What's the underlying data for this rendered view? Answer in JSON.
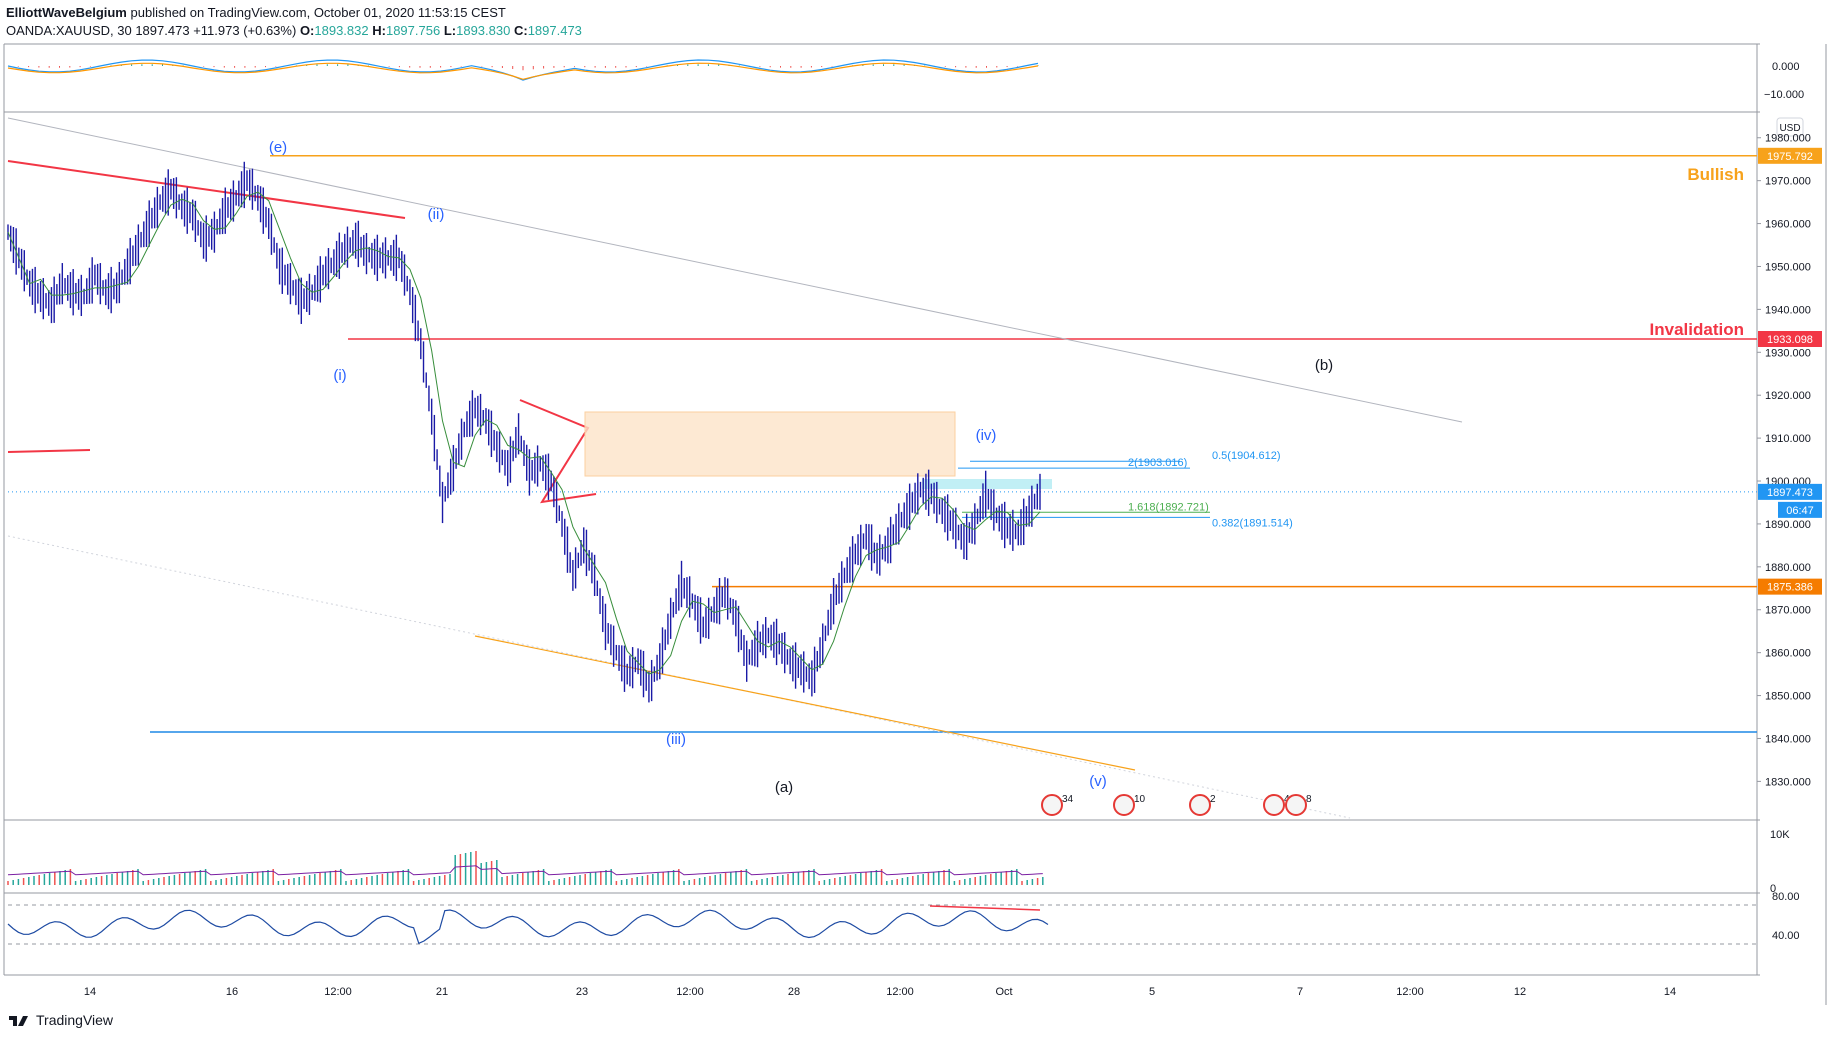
{
  "header": {
    "publisher": "ElliottWaveBelgium",
    "published_text": "published on TradingView.com, October 01, 2020 11:53:15 CEST",
    "symbol": "OANDA:XAUUSD, 30",
    "last": "1897.473",
    "change": "+11.973 (+0.63%)",
    "o_label": "O:",
    "o_value": "1893.832",
    "h_label": "H:",
    "h_value": "1897.756",
    "l_label": "L:",
    "l_value": "1893.830",
    "c_label": "C:",
    "c_value": "1897.473"
  },
  "footer": {
    "brand": "TradingView"
  },
  "chart_data": {
    "type": "line",
    "main_pane": {
      "currency_badge": "USD",
      "y_ticks": [
        1980,
        1970,
        1960,
        1950,
        1940,
        1930,
        1920,
        1910,
        1900,
        1890,
        1880,
        1870,
        1860,
        1850,
        1840,
        1830
      ],
      "y_tick_labels": [
        "1980.000",
        "1970.000",
        "1960.000",
        "1950.000",
        "1940.000",
        "1930.000",
        "1920.000",
        "1910.000",
        "1900.000",
        "1890.000",
        "1880.000",
        "1870.000",
        "1860.000",
        "1850.000",
        "1840.000",
        "1830.000"
      ],
      "ylim": [
        1821,
        1986
      ],
      "price_labels": [
        {
          "value": 1975.792,
          "text": "1975.792",
          "color": "#f7a21b"
        },
        {
          "value": 1933.098,
          "text": "1933.098",
          "color": "#f23645"
        },
        {
          "value": 1897.473,
          "text": "1897.473",
          "color": "#2196f3"
        },
        {
          "value": 1875.386,
          "text": "1875.386",
          "color": "#f57c00"
        }
      ],
      "countdown": "06:47",
      "price_series": [
        [
          0,
          1958
        ],
        [
          2,
          1952
        ],
        [
          4,
          1946
        ],
        [
          6,
          1943
        ],
        [
          8,
          1941
        ],
        [
          10,
          1946
        ],
        [
          12,
          1944
        ],
        [
          14,
          1943
        ],
        [
          16,
          1948
        ],
        [
          18,
          1944
        ],
        [
          20,
          1945
        ],
        [
          22,
          1950
        ],
        [
          24,
          1955
        ],
        [
          26,
          1960
        ],
        [
          28,
          1965
        ],
        [
          30,
          1968
        ],
        [
          32,
          1964
        ],
        [
          34,
          1962
        ],
        [
          36,
          1956
        ],
        [
          38,
          1958
        ],
        [
          40,
          1963
        ],
        [
          42,
          1966
        ],
        [
          44,
          1970
        ],
        [
          46,
          1966
        ],
        [
          48,
          1960
        ],
        [
          50,
          1950
        ],
        [
          52,
          1946
        ],
        [
          54,
          1942
        ],
        [
          56,
          1944
        ],
        [
          58,
          1948
        ],
        [
          60,
          1951
        ],
        [
          62,
          1954
        ],
        [
          64,
          1956
        ],
        [
          66,
          1953
        ],
        [
          68,
          1952
        ],
        [
          70,
          1952
        ],
        [
          72,
          1952
        ],
        [
          74,
          1944
        ],
        [
          76,
          1932
        ],
        [
          78,
          1915
        ],
        [
          80,
          1895
        ],
        [
          82,
          1903
        ],
        [
          84,
          1912
        ],
        [
          86,
          1917
        ],
        [
          88,
          1914
        ],
        [
          90,
          1908
        ],
        [
          92,
          1903
        ],
        [
          94,
          1911
        ],
        [
          96,
          1902
        ],
        [
          98,
          1904
        ],
        [
          100,
          1900
        ],
        [
          102,
          1890
        ],
        [
          104,
          1878
        ],
        [
          106,
          1885
        ],
        [
          108,
          1878
        ],
        [
          110,
          1866
        ],
        [
          112,
          1860
        ],
        [
          114,
          1855
        ],
        [
          116,
          1858
        ],
        [
          118,
          1852
        ],
        [
          120,
          1858
        ],
        [
          122,
          1868
        ],
        [
          124,
          1876
        ],
        [
          126,
          1872
        ],
        [
          128,
          1866
        ],
        [
          130,
          1870
        ],
        [
          132,
          1874
        ],
        [
          134,
          1868
        ],
        [
          136,
          1858
        ],
        [
          138,
          1862
        ],
        [
          140,
          1864
        ],
        [
          142,
          1862
        ],
        [
          144,
          1858
        ],
        [
          146,
          1856
        ],
        [
          148,
          1854
        ],
        [
          150,
          1862
        ],
        [
          152,
          1872
        ],
        [
          154,
          1878
        ],
        [
          156,
          1883
        ],
        [
          158,
          1887
        ],
        [
          160,
          1882
        ],
        [
          162,
          1885
        ],
        [
          164,
          1890
        ],
        [
          166,
          1894
        ],
        [
          168,
          1898
        ],
        [
          170,
          1897
        ],
        [
          172,
          1893
        ],
        [
          174,
          1890
        ],
        [
          176,
          1886
        ],
        [
          178,
          1890
        ],
        [
          180,
          1897
        ],
        [
          182,
          1892
        ],
        [
          184,
          1889
        ],
        [
          186,
          1888
        ],
        [
          188,
          1893
        ],
        [
          190,
          1897.473
        ]
      ],
      "lines": [
        {
          "name": "Bullish",
          "color": "#f7a21b",
          "y": 1975.792
        },
        {
          "name": "Invalidation",
          "color": "#f23645",
          "y": 1933.098
        },
        {
          "name": "",
          "color": "#f57c00",
          "y": 1875.386
        },
        {
          "name": "",
          "color": "#1e88e5",
          "y": 1841.5
        }
      ],
      "labels": {
        "e": "(e)",
        "ii": "(ii)",
        "i": "(i)",
        "iii": "(iii)",
        "iv": "(iv)",
        "v": "(v)",
        "a": "(a)",
        "b": "(b)",
        "bullish": "Bullish",
        "invalidation": "Invalidation"
      },
      "fib": [
        {
          "text": "2(1903.016)",
          "color": "#2196f3",
          "value": 1903.016
        },
        {
          "text": "0.5(1904.612)",
          "color": "#2196f3",
          "value": 1904.612
        },
        {
          "text": "1.618(1892.721)",
          "color": "#4caf50",
          "value": 1892.721
        },
        {
          "text": "0.382(1891.514)",
          "color": "#2196f3",
          "value": 1891.514
        }
      ],
      "event_counts": [
        "34",
        "10",
        "2",
        "4",
        "8"
      ]
    },
    "macd_pane": {
      "y_tick_labels": [
        "0.000",
        "−10.000"
      ]
    },
    "volume_pane": {
      "y_tick_labels": [
        "10K",
        "0"
      ]
    },
    "rsi_pane": {
      "y_tick_labels": [
        "80.00",
        "40.00"
      ]
    },
    "x_tick_labels": [
      "14",
      "16",
      "12:00",
      "21",
      "23",
      "12:00",
      "28",
      "12:00",
      "Oct",
      "5",
      "7",
      "12:00",
      "12",
      "14"
    ]
  }
}
